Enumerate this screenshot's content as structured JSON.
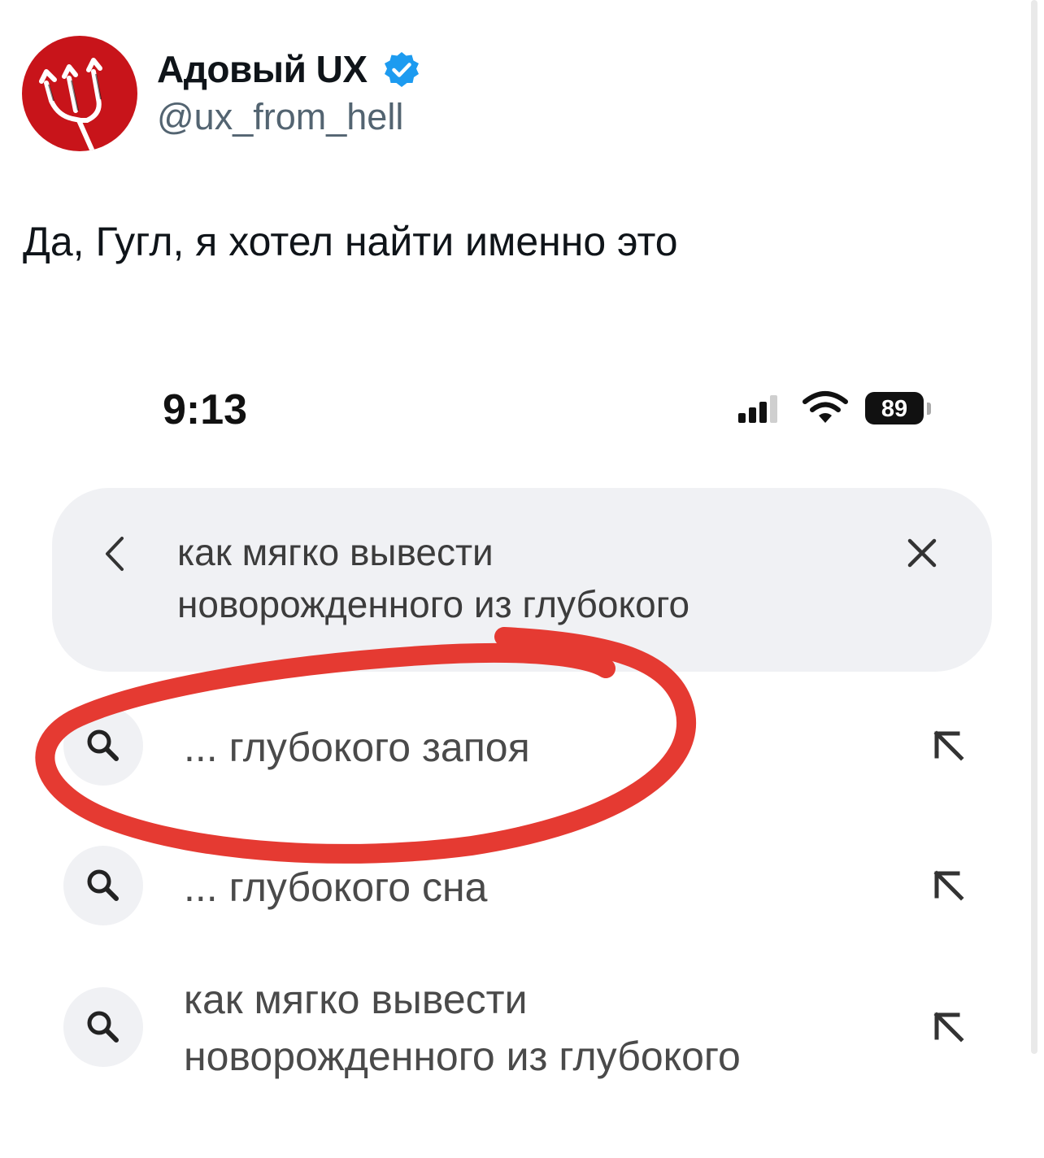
{
  "tweet": {
    "author_name": "Адовый UX",
    "author_handle": "@ux_from_hell",
    "text": "Да, Гугл, я хотел найти именно это"
  },
  "phone": {
    "status": {
      "time": "9:13",
      "battery": "89"
    },
    "search": {
      "query_line1": "как мягко вывести",
      "query_line2": "новорожденного из глубокого"
    },
    "suggestions": [
      {
        "line1": "... глубокого запоя"
      },
      {
        "line1": "... глубокого сна"
      },
      {
        "line1": "как мягко вывести",
        "line2": "новорожденного из глубокого"
      }
    ]
  },
  "colors": {
    "annotation_red": "#e53a32",
    "verified_blue": "#1d9bf0",
    "avatar_red": "#c8141a"
  },
  "icons": [
    "trident-logo-icon",
    "verified-badge-icon",
    "signal-icon",
    "wifi-icon",
    "battery-icon",
    "back-chevron-icon",
    "close-icon",
    "search-icon",
    "arrow-up-left-icon"
  ]
}
